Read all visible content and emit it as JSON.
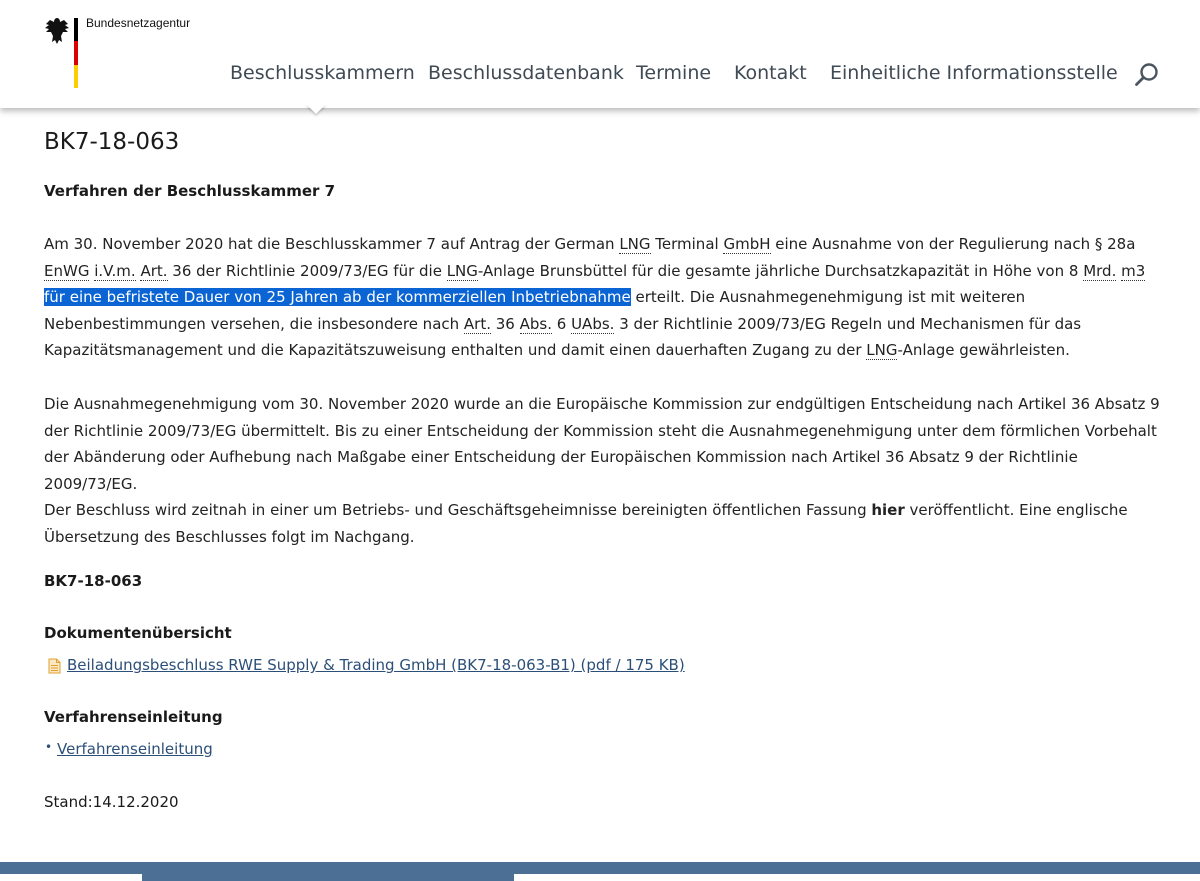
{
  "brand": {
    "name": "Bundesnetzagentur"
  },
  "nav": {
    "items": [
      "Beschlusskammern",
      "Beschlussdatenbank",
      "Termine",
      "Kontakt",
      "Einheitliche Informationsstelle"
    ]
  },
  "colors": {
    "nav_text": "#3f4a55",
    "highlight": "#0b64d3",
    "link": "#2c4f78",
    "footer": "#4c6f96"
  },
  "page": {
    "title": "BK7-18-063",
    "subtitle": "Verfahren der Beschlusskammer 7",
    "para1": {
      "t1": "Am 30. November 2020 hat die Beschlusskammer 7 auf Antrag der German ",
      "a1": "LNG",
      "t2": " Terminal ",
      "a2": "GmbH",
      "t3": " eine Ausnahme von der Regulierung nach § 28a ",
      "a3": "EnWG",
      "t4": " ",
      "a4": "i.V.m.",
      "t5": " ",
      "a5": "Art.",
      "t6": " 36 der Richtlinie 2009/73/EG für die ",
      "a6": "LNG",
      "t7": "-Anlage Brunsbüttel für die gesamte jährliche Durchsatzkapazität in Höhe von 8 ",
      "a7": "Mrd.",
      "t8": " ",
      "a8": "m3",
      "hl": " für eine befristete Dauer von 25 Jahren ab der kommerziellen Inbetriebnahme",
      "t9": " erteilt. Die Ausnahmegenehmigung ist mit weiteren Nebenbestimmungen versehen, die insbesondere nach ",
      "a9": "Art.",
      "t10": " 36 ",
      "a10": "Abs.",
      "t11": " 6 ",
      "a11": "UAbs.",
      "t12": " 3 der Richtlinie 2009/73/EG Regeln und Mechanismen für das Kapazitätsmanagement und die Kapazitätszuweisung enthalten und damit einen dauerhaften Zugang zu der ",
      "a12": "LNG",
      "t13": "-Anlage gewährleisten."
    },
    "para2": "Die Ausnahmegenehmigung vom 30. November 2020 wurde an die Europäische Kommission zur endgültigen Entscheidung nach Artikel 36 Absatz 9 der Richtlinie 2009/73/EG übermittelt. Bis zu einer Entscheidung der Kommission steht die Ausnahmegenehmigung unter dem förmlichen Vorbehalt der Abänderung oder Aufhebung nach Maßgabe einer Entscheidung der Europäischen Kommission nach Artikel 36 Absatz 9 der Richtlinie 2009/73/EG.",
    "para3": {
      "t1": "Der Beschluss wird zeitnah in einer um Betriebs- und Geschäftsgeheimnisse bereinigten öffentlichen Fassung ",
      "bold": "hier",
      "t2": " veröffentlicht. Eine englische Übersetzung des Beschlusses folgt im Nachgang."
    },
    "case_number": "BK7-18-063",
    "documents_heading": "Dokumentenübersicht",
    "document_link": "Beiladungsbeschluss RWE Supply & Trading GmbH (BK7-18-063-B1) (pdf / 175 KB)",
    "procedure_heading": "Verfahrenseinleitung",
    "procedure_link": "Verfahrenseinleitung",
    "stand": "Stand:14.12.2020"
  }
}
